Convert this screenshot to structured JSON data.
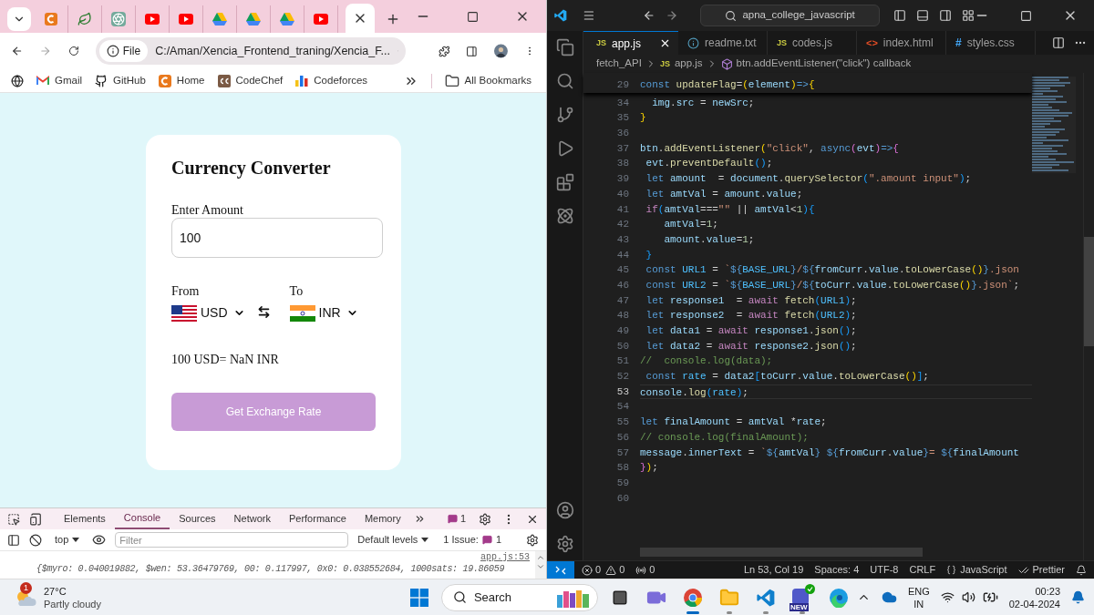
{
  "browser": {
    "tabs": [
      {
        "selected": false
      },
      {
        "selected": false
      },
      {
        "selected": false
      },
      {
        "selected": false
      },
      {
        "selected": false
      },
      {
        "selected": false
      },
      {
        "selected": false
      },
      {
        "selected": false
      },
      {
        "selected": false
      },
      {
        "selected": true
      }
    ],
    "address": {
      "chip": "File",
      "url": "C:/Aman/Xencia_Frontend_traning/Xencia_F..."
    },
    "bookmarks": [
      "Gmail",
      "GitHub",
      "Home",
      "CodeChef",
      "Codeforces"
    ],
    "all_bookmarks": "All Bookmarks"
  },
  "page": {
    "title": "Currency Converter",
    "amount_label": "Enter Amount",
    "amount_value": "100",
    "from": {
      "label": "From",
      "currency": "USD"
    },
    "to": {
      "label": "To",
      "currency": "INR"
    },
    "message": "100 USD= NaN INR",
    "button": "Get Exchange Rate"
  },
  "devtools": {
    "tabs": [
      {
        "label": "Elements",
        "selected": false
      },
      {
        "label": "Console",
        "selected": true
      },
      {
        "label": "Sources",
        "selected": false
      },
      {
        "label": "Network",
        "selected": false
      },
      {
        "label": "Performance",
        "selected": false
      },
      {
        "label": "Memory",
        "selected": false
      }
    ],
    "issues_count": "1",
    "context": "top",
    "filter_placeholder": "Filter",
    "levels": "Default levels",
    "issues_label": "1 Issue:",
    "issues_badge": "1",
    "log_source": "app.js:53",
    "log_text": "{$myro: 0.040019882, $wen: 53.36479769, 00: 0.117997, 0x0: 0.038552684, 1000sats: 19.86059"
  },
  "vscode": {
    "search": "apna_college_javascript",
    "tabs": [
      {
        "label": "app.js",
        "kind": "js",
        "icon": "JS",
        "selected": true
      },
      {
        "label": "readme.txt",
        "kind": "info",
        "selected": false
      },
      {
        "label": "codes.js",
        "kind": "js",
        "icon": "JS",
        "selected": false
      },
      {
        "label": "index.html",
        "kind": "html",
        "icon": "<>",
        "selected": false
      },
      {
        "label": "styles.css",
        "kind": "css",
        "icon": "#",
        "selected": false
      }
    ],
    "breadcrumb": {
      "folder": "fetch_API",
      "file_icon": "JS",
      "file": "app.js",
      "symbol": "btn.addEventListener(\"click\") callback"
    },
    "sticky": {
      "number": "29",
      "tokens": [
        {
          "kind": "k",
          "text": "const "
        },
        {
          "kind": "f",
          "text": "updateFlag"
        },
        {
          "kind": "p",
          "text": "="
        },
        {
          "kind": "b",
          "text": "("
        },
        {
          "kind": "v",
          "text": "element"
        },
        {
          "kind": "b",
          "text": ")"
        },
        {
          "kind": "k",
          "text": "=>"
        },
        {
          "kind": "b",
          "text": "{"
        }
      ]
    },
    "lines": [
      {
        "number": "34",
        "current": false,
        "tokens": [
          {
            "kind": "v",
            "text": "  img"
          },
          {
            "kind": "p",
            "text": "."
          },
          {
            "kind": "v",
            "text": "src"
          },
          {
            "kind": "p",
            "text": " = "
          },
          {
            "kind": "v",
            "text": "newSrc"
          },
          {
            "kind": "p",
            "text": ";"
          }
        ]
      },
      {
        "number": "35",
        "current": false,
        "tokens": [
          {
            "kind": "b",
            "text": "}"
          }
        ]
      },
      {
        "number": "36",
        "current": false
      },
      {
        "number": "37",
        "current": false,
        "tokens": [
          {
            "kind": "v",
            "text": "btn"
          },
          {
            "kind": "p",
            "text": "."
          },
          {
            "kind": "f",
            "text": "addEventListener"
          },
          {
            "kind": "b",
            "text": "("
          },
          {
            "kind": "s",
            "text": "\"click\""
          },
          {
            "kind": "p",
            "text": ", "
          },
          {
            "kind": "k",
            "text": "async"
          },
          {
            "kind": "m",
            "text": "("
          },
          {
            "kind": "v",
            "text": "evt"
          },
          {
            "kind": "m",
            "text": ")"
          },
          {
            "kind": "k",
            "text": "=>"
          },
          {
            "kind": "m",
            "text": "{"
          }
        ]
      },
      {
        "number": "38",
        "current": false,
        "tokens": [
          {
            "kind": "v",
            "text": " evt"
          },
          {
            "kind": "p",
            "text": "."
          },
          {
            "kind": "f",
            "text": "preventDefault"
          },
          {
            "kind": "u",
            "text": "()"
          },
          {
            "kind": "p",
            "text": ";"
          }
        ]
      },
      {
        "number": "39",
        "current": false,
        "tokens": [
          {
            "kind": "k",
            "text": " let "
          },
          {
            "kind": "v",
            "text": "amount"
          },
          {
            "kind": "p",
            "text": "  = "
          },
          {
            "kind": "v",
            "text": "document"
          },
          {
            "kind": "p",
            "text": "."
          },
          {
            "kind": "f",
            "text": "querySelector"
          },
          {
            "kind": "u",
            "text": "("
          },
          {
            "kind": "s",
            "text": "\".amount input\""
          },
          {
            "kind": "u",
            "text": ")"
          },
          {
            "kind": "p",
            "text": ";"
          }
        ]
      },
      {
        "number": "40",
        "current": false,
        "tokens": [
          {
            "kind": "k",
            "text": " let "
          },
          {
            "kind": "v",
            "text": "amtVal"
          },
          {
            "kind": "p",
            "text": " = "
          },
          {
            "kind": "v",
            "text": "amount"
          },
          {
            "kind": "p",
            "text": "."
          },
          {
            "kind": "v",
            "text": "value"
          },
          {
            "kind": "p",
            "text": ";"
          }
        ]
      },
      {
        "number": "41",
        "current": false,
        "tokens": [
          {
            "kind": "a",
            "text": " if"
          },
          {
            "kind": "u",
            "text": "("
          },
          {
            "kind": "v",
            "text": "amtVal"
          },
          {
            "kind": "p",
            "text": "==="
          },
          {
            "kind": "s",
            "text": "\"\""
          },
          {
            "kind": "p",
            "text": " || "
          },
          {
            "kind": "v",
            "text": "amtVal"
          },
          {
            "kind": "p",
            "text": "<"
          },
          {
            "kind": "n",
            "text": "1"
          },
          {
            "kind": "u",
            "text": ")"
          },
          {
            "kind": "u",
            "text": "{"
          }
        ]
      },
      {
        "number": "42",
        "current": false,
        "tokens": [
          {
            "kind": "v",
            "text": "    amtVal"
          },
          {
            "kind": "p",
            "text": "="
          },
          {
            "kind": "n",
            "text": "1"
          },
          {
            "kind": "p",
            "text": ";"
          }
        ]
      },
      {
        "number": "43",
        "current": false,
        "tokens": [
          {
            "kind": "v",
            "text": "    amount"
          },
          {
            "kind": "p",
            "text": "."
          },
          {
            "kind": "v",
            "text": "value"
          },
          {
            "kind": "p",
            "text": "="
          },
          {
            "kind": "n",
            "text": "1"
          },
          {
            "kind": "p",
            "text": ";"
          }
        ]
      },
      {
        "number": "44",
        "current": false,
        "tokens": [
          {
            "kind": "u",
            "text": " }"
          }
        ]
      },
      {
        "number": "45",
        "current": false,
        "tokens": [
          {
            "kind": "k",
            "text": " const "
          },
          {
            "kind": "c",
            "text": "URL1"
          },
          {
            "kind": "p",
            "text": " = "
          },
          {
            "kind": "s",
            "text": "`"
          },
          {
            "kind": "k",
            "text": "${"
          },
          {
            "kind": "c",
            "text": "BASE_URL"
          },
          {
            "kind": "k",
            "text": "}"
          },
          {
            "kind": "s",
            "text": "/"
          },
          {
            "kind": "k",
            "text": "${"
          },
          {
            "kind": "v",
            "text": "fromCurr"
          },
          {
            "kind": "p",
            "text": "."
          },
          {
            "kind": "v",
            "text": "value"
          },
          {
            "kind": "p",
            "text": "."
          },
          {
            "kind": "f",
            "text": "toLowerCase"
          },
          {
            "kind": "b",
            "text": "()"
          },
          {
            "kind": "k",
            "text": "}"
          },
          {
            "kind": "s",
            "text": ".json"
          }
        ]
      },
      {
        "number": "46",
        "current": false,
        "tokens": [
          {
            "kind": "k",
            "text": " const "
          },
          {
            "kind": "c",
            "text": "URL2"
          },
          {
            "kind": "p",
            "text": " = "
          },
          {
            "kind": "s",
            "text": "`"
          },
          {
            "kind": "k",
            "text": "${"
          },
          {
            "kind": "c",
            "text": "BASE_URL"
          },
          {
            "kind": "k",
            "text": "}"
          },
          {
            "kind": "s",
            "text": "/"
          },
          {
            "kind": "k",
            "text": "${"
          },
          {
            "kind": "v",
            "text": "toCurr"
          },
          {
            "kind": "p",
            "text": "."
          },
          {
            "kind": "v",
            "text": "value"
          },
          {
            "kind": "p",
            "text": "."
          },
          {
            "kind": "f",
            "text": "toLowerCase"
          },
          {
            "kind": "b",
            "text": "()"
          },
          {
            "kind": "k",
            "text": "}"
          },
          {
            "kind": "s",
            "text": ".json`"
          },
          {
            "kind": "p",
            "text": ";"
          }
        ]
      },
      {
        "number": "47",
        "current": false,
        "tokens": [
          {
            "kind": "k",
            "text": " let "
          },
          {
            "kind": "v",
            "text": "response1"
          },
          {
            "kind": "p",
            "text": "  = "
          },
          {
            "kind": "a",
            "text": "await "
          },
          {
            "kind": "f",
            "text": "fetch"
          },
          {
            "kind": "u",
            "text": "("
          },
          {
            "kind": "c",
            "text": "URL1"
          },
          {
            "kind": "u",
            "text": ")"
          },
          {
            "kind": "p",
            "text": ";"
          }
        ]
      },
      {
        "number": "48",
        "current": false,
        "tokens": [
          {
            "kind": "k",
            "text": " let "
          },
          {
            "kind": "v",
            "text": "response2"
          },
          {
            "kind": "p",
            "text": "  = "
          },
          {
            "kind": "a",
            "text": "await "
          },
          {
            "kind": "f",
            "text": "fetch"
          },
          {
            "kind": "u",
            "text": "("
          },
          {
            "kind": "c",
            "text": "URL2"
          },
          {
            "kind": "u",
            "text": ")"
          },
          {
            "kind": "p",
            "text": ";"
          }
        ]
      },
      {
        "number": "49",
        "current": false,
        "tokens": [
          {
            "kind": "k",
            "text": " let "
          },
          {
            "kind": "v",
            "text": "data1"
          },
          {
            "kind": "p",
            "text": " = "
          },
          {
            "kind": "a",
            "text": "await "
          },
          {
            "kind": "v",
            "text": "response1"
          },
          {
            "kind": "p",
            "text": "."
          },
          {
            "kind": "f",
            "text": "json"
          },
          {
            "kind": "u",
            "text": "()"
          },
          {
            "kind": "p",
            "text": ";"
          }
        ]
      },
      {
        "number": "50",
        "current": false,
        "tokens": [
          {
            "kind": "k",
            "text": " let "
          },
          {
            "kind": "v",
            "text": "data2"
          },
          {
            "kind": "p",
            "text": " = "
          },
          {
            "kind": "a",
            "text": "await "
          },
          {
            "kind": "v",
            "text": "response2"
          },
          {
            "kind": "p",
            "text": "."
          },
          {
            "kind": "f",
            "text": "json"
          },
          {
            "kind": "u",
            "text": "()"
          },
          {
            "kind": "p",
            "text": ";"
          }
        ]
      },
      {
        "number": "51",
        "current": false,
        "tokens": [
          {
            "kind": "o",
            "text": "//  console.log(data);"
          }
        ]
      },
      {
        "number": "52",
        "current": false,
        "tokens": [
          {
            "kind": "k",
            "text": " const "
          },
          {
            "kind": "c",
            "text": "rate"
          },
          {
            "kind": "p",
            "text": " = "
          },
          {
            "kind": "v",
            "text": "data2"
          },
          {
            "kind": "u",
            "text": "["
          },
          {
            "kind": "v",
            "text": "toCurr"
          },
          {
            "kind": "p",
            "text": "."
          },
          {
            "kind": "v",
            "text": "value"
          },
          {
            "kind": "p",
            "text": "."
          },
          {
            "kind": "f",
            "text": "toLowerCase"
          },
          {
            "kind": "b",
            "text": "()"
          },
          {
            "kind": "u",
            "text": "]"
          },
          {
            "kind": "p",
            "text": ";"
          }
        ]
      },
      {
        "number": "53",
        "current": true,
        "tokens": [
          {
            "kind": "v",
            "text": "console"
          },
          {
            "kind": "p",
            "text": "."
          },
          {
            "kind": "f",
            "text": "log"
          },
          {
            "kind": "u",
            "text": "("
          },
          {
            "kind": "c",
            "text": "rate"
          },
          {
            "kind": "u",
            "text": ")"
          },
          {
            "kind": "p",
            "text": ";"
          }
        ]
      },
      {
        "number": "54",
        "current": false
      },
      {
        "number": "55",
        "current": false,
        "tokens": [
          {
            "kind": "k",
            "text": "let "
          },
          {
            "kind": "v",
            "text": "finalAmount"
          },
          {
            "kind": "p",
            "text": " = "
          },
          {
            "kind": "v",
            "text": "amtVal"
          },
          {
            "kind": "p",
            "text": " *"
          },
          {
            "kind": "v",
            "text": "rate"
          },
          {
            "kind": "p",
            "text": ";"
          }
        ]
      },
      {
        "number": "56",
        "current": false,
        "tokens": [
          {
            "kind": "o",
            "text": "// console.log(finalAmount);"
          }
        ]
      },
      {
        "number": "57",
        "current": false,
        "tokens": [
          {
            "kind": "v",
            "text": "message"
          },
          {
            "kind": "p",
            "text": "."
          },
          {
            "kind": "v",
            "text": "innerText"
          },
          {
            "kind": "p",
            "text": " = "
          },
          {
            "kind": "s",
            "text": "`"
          },
          {
            "kind": "k",
            "text": "${"
          },
          {
            "kind": "v",
            "text": "amtVal"
          },
          {
            "kind": "k",
            "text": "} ${"
          },
          {
            "kind": "v",
            "text": "fromCurr"
          },
          {
            "kind": "p",
            "text": "."
          },
          {
            "kind": "v",
            "text": "value"
          },
          {
            "kind": "k",
            "text": "}"
          },
          {
            "kind": "s",
            "text": "= "
          },
          {
            "kind": "k",
            "text": "${"
          },
          {
            "kind": "v",
            "text": "finalAmount"
          }
        ]
      },
      {
        "number": "58",
        "current": false,
        "tokens": [
          {
            "kind": "m",
            "text": "}"
          },
          {
            "kind": "b",
            "text": ")"
          },
          {
            "kind": "p",
            "text": ";"
          }
        ]
      },
      {
        "number": "59",
        "current": false
      },
      {
        "number": "60",
        "current": false
      }
    ],
    "status": {
      "errors": "0",
      "warnings": "0",
      "ports": "0",
      "position": "Ln 53, Col 19",
      "indent": "Spaces: 4",
      "encoding": "UTF-8",
      "eol": "CRLF",
      "language": "JavaScript",
      "formatter": "Prettier"
    }
  },
  "taskbar": {
    "weather_badge": "1",
    "temperature": "27°C",
    "weather": "Partly cloudy",
    "search_placeholder": "Search",
    "teams_badge": "NEW",
    "language": "ENG",
    "region": "IN",
    "time": "00:23",
    "date": "02-04-2024"
  }
}
